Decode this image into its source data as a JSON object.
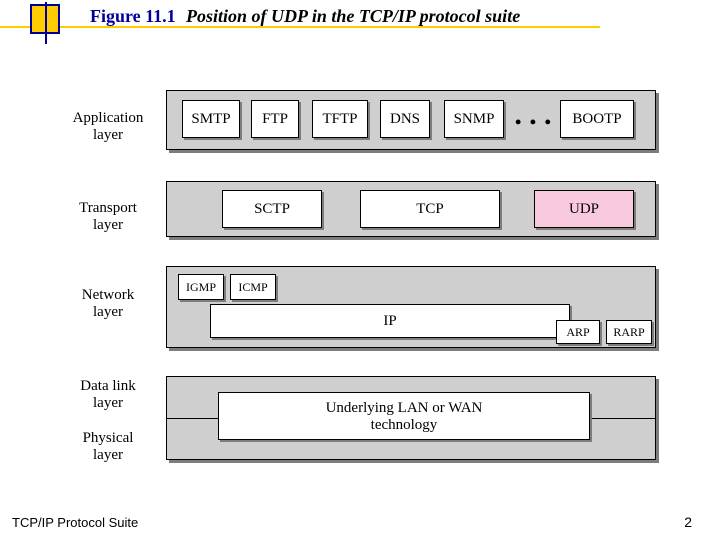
{
  "figure": {
    "label": "Figure 11.1",
    "title": "Position of UDP in the TCP/IP protocol suite"
  },
  "layers": {
    "application": "Application\nlayer",
    "transport": "Transport\nlayer",
    "network": "Network\nlayer",
    "datalink": "Data link\nlayer",
    "physical": "Physical\nlayer"
  },
  "app_boxes": {
    "smtp": "SMTP",
    "ftp": "FTP",
    "tftp": "TFTP",
    "dns": "DNS",
    "snmp": "SNMP",
    "dots": "• • •",
    "bootp": "BOOTP"
  },
  "transport_boxes": {
    "sctp": "SCTP",
    "tcp": "TCP",
    "udp": "UDP"
  },
  "network_boxes": {
    "igmp": "IGMP",
    "icmp": "ICMP",
    "ip": "IP",
    "arp": "ARP",
    "rarp": "RARP"
  },
  "dlphy_box": "Underlying LAN or WAN\ntechnology",
  "footer": {
    "left": "TCP/IP Protocol Suite",
    "page": "2"
  },
  "colors": {
    "accent_yellow": "#ffcc00",
    "accent_blue": "#000099",
    "udp_highlight": "#f9c9e0"
  }
}
